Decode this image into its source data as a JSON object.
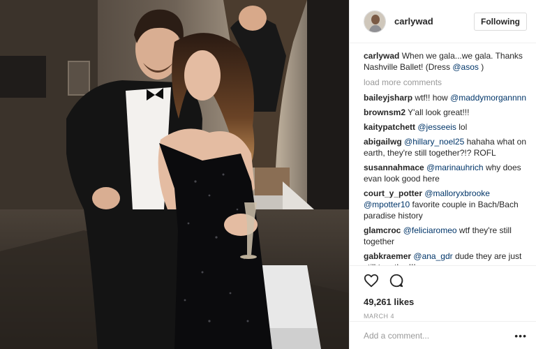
{
  "header": {
    "username": "carlywad",
    "follow_label": "Following"
  },
  "caption": {
    "username": "carlywad",
    "text_before": "When we gala...we gala. Thanks Nashville Ballet! (Dress ",
    "mention": "@asos",
    "text_after": " )"
  },
  "load_more_label": "load more comments",
  "comments": [
    {
      "user": "baileyjsharp",
      "text_before": "wtf!! how",
      "mention": "@maddymorgannnn",
      "text_after": ""
    },
    {
      "user": "brownsm2",
      "text_before": "Y'all look great!!!",
      "mention": "",
      "text_after": ""
    },
    {
      "user": "kaitypatchett",
      "text_before": "",
      "mention": "@jesseeis",
      "text_after": " lol"
    },
    {
      "user": "abigailwg",
      "text_before": "",
      "mention": "@hillary_noel25",
      "text_after": " hahaha what on earth, they're still together?!? ROFL"
    },
    {
      "user": "susannahmace",
      "text_before": "",
      "mention": "@marinauhrich",
      "text_after": " why does evan look good here"
    },
    {
      "user": "court_y_potter",
      "text_before": "",
      "mention": "@malloryxbrooke @mpotter10",
      "text_after": " favorite couple in Bach/Bach paradise history"
    },
    {
      "user": "glamcroc",
      "text_before": "",
      "mention": "@feliciaromeo",
      "text_after": " wtf they're still together"
    },
    {
      "user": "gabkraemer",
      "text_before": "",
      "mention": "@ana_gdr",
      "text_after": " dude they are just still together!!!"
    }
  ],
  "actions": {
    "like_icon": "heart-icon",
    "comment_icon": "comment-icon",
    "likes_text": "49,261 likes",
    "date_text": "MARCH 4"
  },
  "add_comment": {
    "placeholder": "Add a comment...",
    "more_label": "•••"
  },
  "colors": {
    "mention": "#003569",
    "muted": "#999999",
    "border": "#efefef",
    "text": "#262626"
  }
}
